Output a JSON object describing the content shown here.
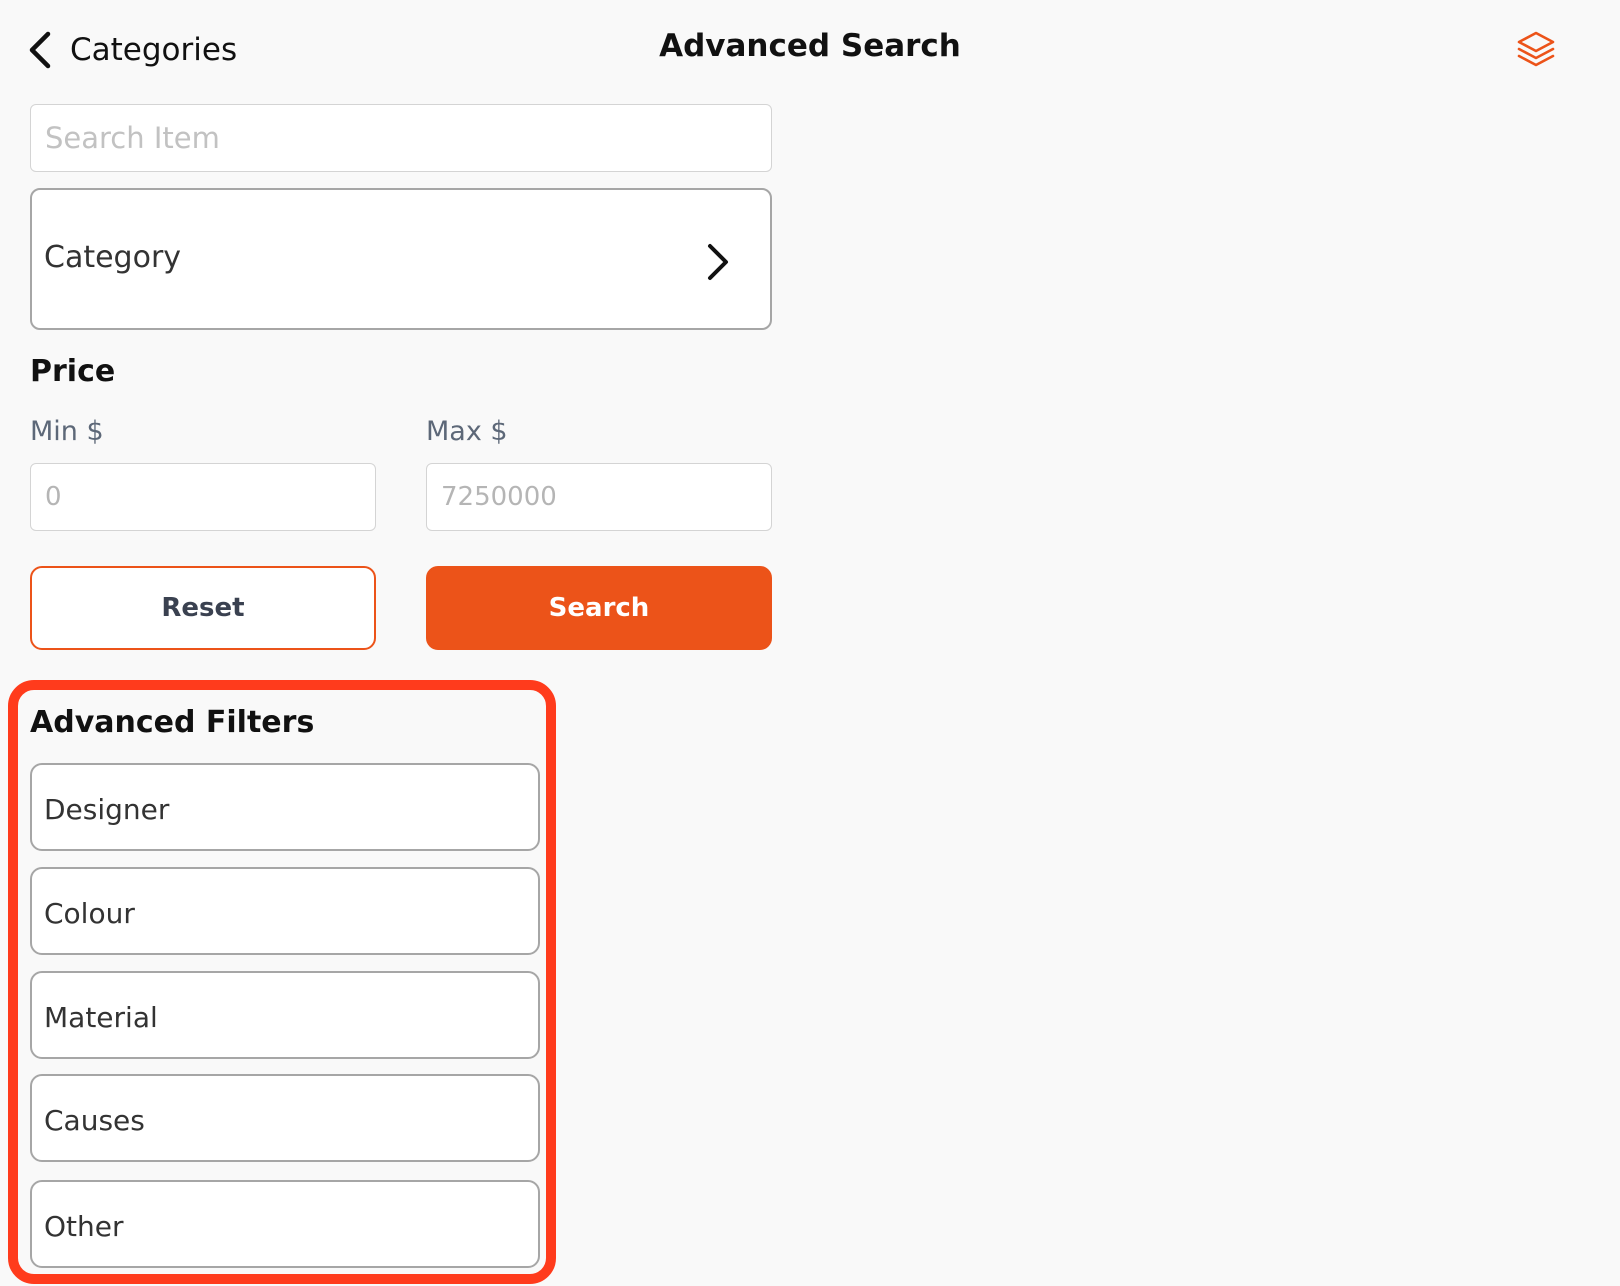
{
  "nav": {
    "back_label": "Categories",
    "title": "Advanced Search",
    "action_icon": "layers-icon"
  },
  "search": {
    "value": "",
    "placeholder": "Search Item"
  },
  "category": {
    "label": "Category"
  },
  "price": {
    "heading": "Price",
    "min_label": "Min $",
    "min_placeholder": "0",
    "max_label": "Max $",
    "max_placeholder": "7250000"
  },
  "actions": {
    "reset_label": "Reset",
    "search_label": "Search"
  },
  "advanced_filters": {
    "heading": "Advanced Filters",
    "items": [
      {
        "label": "Designer"
      },
      {
        "label": "Colour"
      },
      {
        "label": "Material"
      },
      {
        "label": "Causes"
      },
      {
        "label": "Other"
      }
    ]
  },
  "colors": {
    "accent": "#ec5319",
    "highlight": "#ff3b1c"
  }
}
